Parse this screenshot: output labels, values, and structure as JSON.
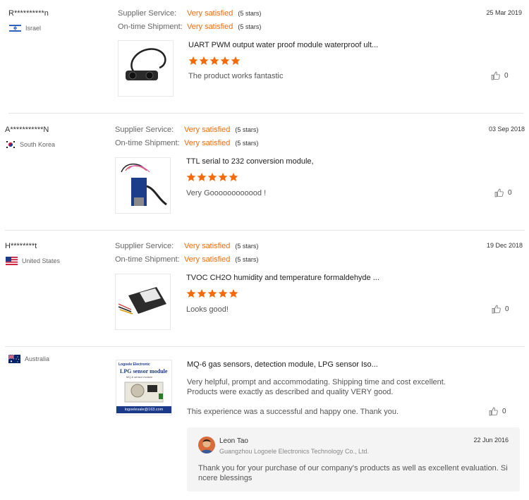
{
  "labels": {
    "supplier_service": "Supplier Service:",
    "on_time_shipment": "On-time Shipment:"
  },
  "colors": {
    "accent": "#f56b0a",
    "separator": "#e4e4e4"
  },
  "reviews": [
    {
      "buyer": "R**********n",
      "country": "Israel",
      "flag_icon": "israel-flag-icon",
      "supplier_service": "Very satisfied",
      "supplier_service_stars": "(5 stars)",
      "shipment": "Very satisfied",
      "shipment_stars": "(5 stars)",
      "date": "25 Mar 2019",
      "product_title": "UART PWM output water proof module waterproof ult...",
      "rating": 5,
      "text": "The product works fantastic",
      "helpful_count": "0"
    },
    {
      "buyer": "A***********N",
      "country": "South Korea",
      "flag_icon": "south-korea-flag-icon",
      "supplier_service": "Very satisfied",
      "supplier_service_stars": "(5 stars)",
      "shipment": "Very satisfied",
      "shipment_stars": "(5 stars)",
      "date": "03 Sep 2018",
      "product_title": "TTL serial to 232 conversion module,",
      "rating": 5,
      "text": "Very Goooooooooood !",
      "helpful_count": "0"
    },
    {
      "buyer": "H********t",
      "country": "United States",
      "flag_icon": "united-states-flag-icon",
      "supplier_service": "Very satisfied",
      "supplier_service_stars": "(5 stars)",
      "shipment": "Very satisfied",
      "shipment_stars": "(5 stars)",
      "date": "19 Dec 2018",
      "product_title": "TVOC CH2O humidity and temperature formaldehyde ...",
      "rating": 5,
      "text": "Looks good!",
      "helpful_count": "0"
    },
    {
      "buyer": "",
      "country": "Australia",
      "flag_icon": "australia-flag-icon",
      "product_title": "MQ-6 gas sensors, detection module, LPG sensor Iso...",
      "text_line1": "Very helpful, prompt and accommodating. Shipping time and cost excellent.",
      "text_line2": "Products were exactly as described and quality VERY good.",
      "text_line3": "This experience was a successful and happy one. Thank you.",
      "helpful_count": "0",
      "thumb_brand": "Logoele Electronic",
      "thumb_title": "LPG sensor module",
      "thumb_subtitle": "MQ-6 sensor module",
      "thumb_email": "logoelesale@163.com",
      "reply": {
        "seller_name": "Leon Tao",
        "company": "Guangzhou Logoele Electronics Technology Co., Ltd.",
        "date": "22 Jun 2016",
        "text_line1": "Thank you for your purchase of our company's products as well as excellent evaluation. Si",
        "text_line2": "ncere blessings"
      }
    }
  ]
}
